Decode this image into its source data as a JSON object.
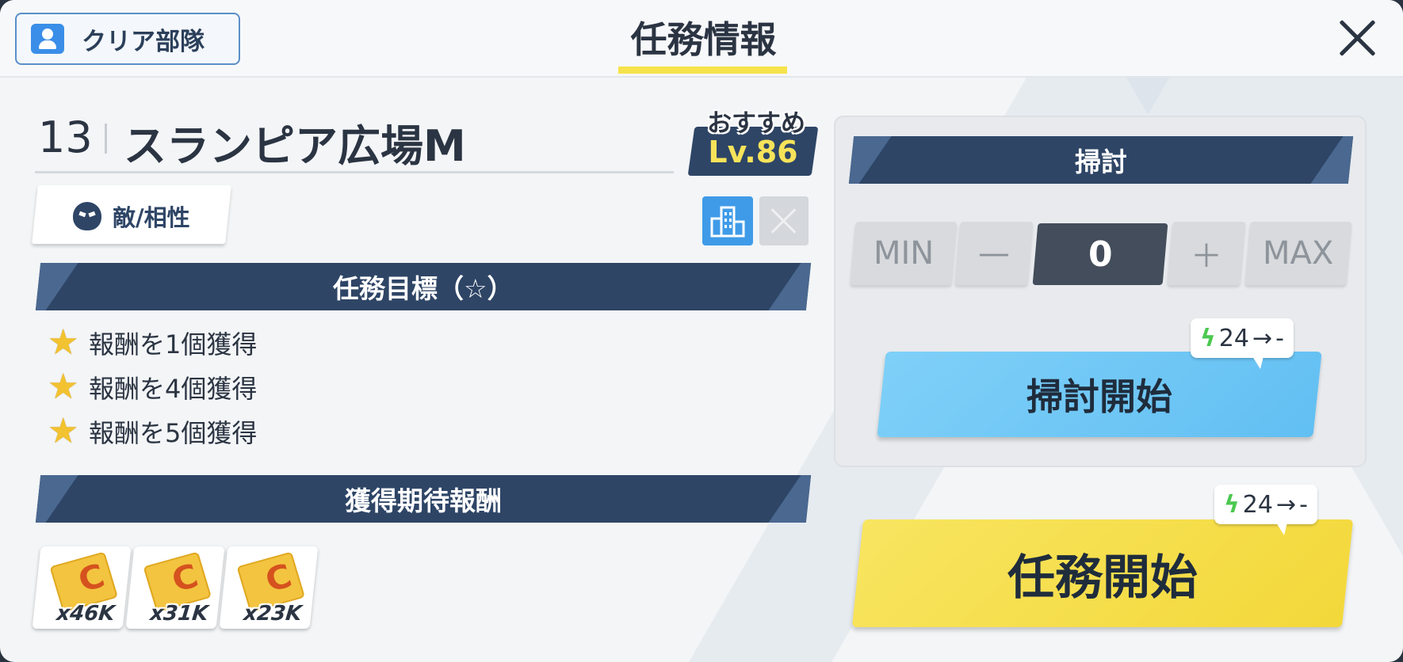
{
  "header": {
    "clear_team_label": "クリア部隊",
    "title": "任務情報"
  },
  "stage": {
    "number": "13",
    "name": "スランピア広場M",
    "recommend_label": "おすすめ",
    "recommend_level": "Lv.86"
  },
  "enemy_button_label": "敵/相性",
  "objectives": {
    "header": "任務目標（☆）",
    "items": [
      "報酬を1個獲得",
      "報酬を4個獲得",
      "報酬を5個獲得"
    ]
  },
  "rewards": {
    "header": "獲得期待報酬",
    "items": [
      {
        "quantity": "x46K",
        "icon": "credit-card-icon"
      },
      {
        "quantity": "x31K",
        "icon": "credit-card-icon"
      },
      {
        "quantity": "x23K",
        "icon": "credit-card-icon"
      }
    ]
  },
  "sweep": {
    "header": "掃討",
    "min_label": "MIN",
    "minus_label": "—",
    "count": "0",
    "plus_label": "＋",
    "max_label": "MAX",
    "cost": {
      "value": "24",
      "arrow": "→",
      "after": "-"
    },
    "start_label": "掃討開始"
  },
  "mission": {
    "cost": {
      "value": "24",
      "arrow": "→",
      "after": "-"
    },
    "start_label": "任務開始"
  },
  "colors": {
    "accent_navy": "#2e4566",
    "highlight_yellow": "#f6e24a",
    "sweep_blue": "#6cc7f5",
    "start_yellow": "#f5de45",
    "ap_green": "#4cc850"
  }
}
